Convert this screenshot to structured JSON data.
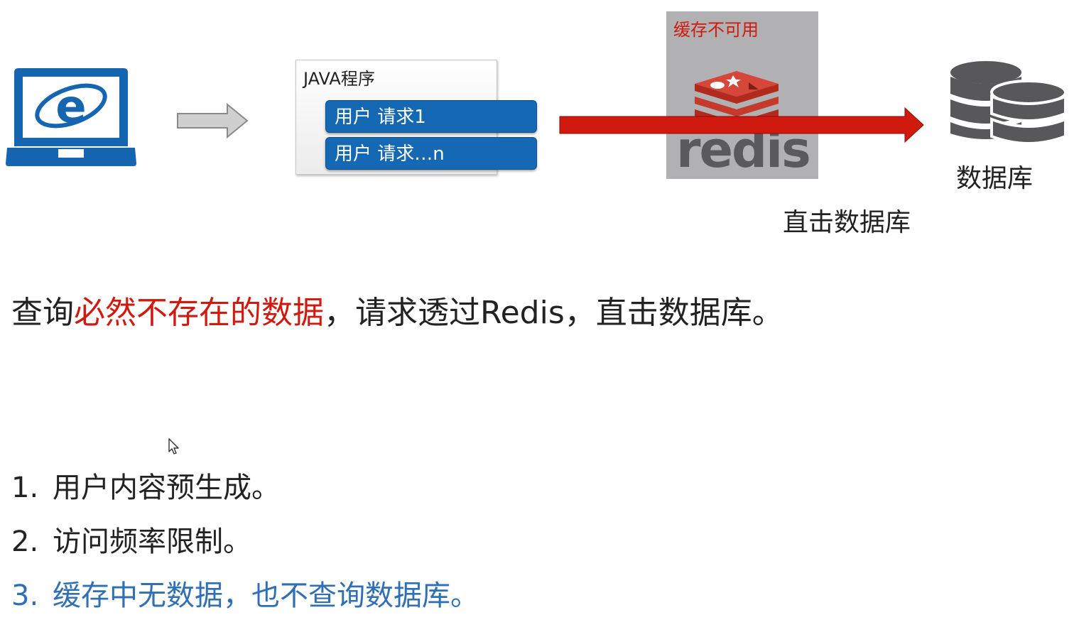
{
  "java_box": {
    "title": "JAVA程序",
    "requests": [
      "用户 请求1",
      "用户 请求…n"
    ]
  },
  "redis": {
    "status": "缓存不可用",
    "logo_text": "redis"
  },
  "database": {
    "label": "数据库"
  },
  "arrow_label": "直击数据库",
  "headline": {
    "prefix": "查询",
    "highlight": "必然不存在的数据",
    "suffix": "，请求透过Redis，直击数据库。"
  },
  "solutions": [
    {
      "num": "1.",
      "text": "用户内容预生成。"
    },
    {
      "num": "2.",
      "text": "访问频率限制。"
    },
    {
      "num": "3.",
      "text": "缓存中无数据，也不查询数据库。"
    }
  ],
  "colors": {
    "accent_blue": "#1568b4",
    "alert_red": "#d0190f",
    "highlight_blue": "#2f6fb3",
    "redis_panel_gray": "#b1b1b3"
  }
}
